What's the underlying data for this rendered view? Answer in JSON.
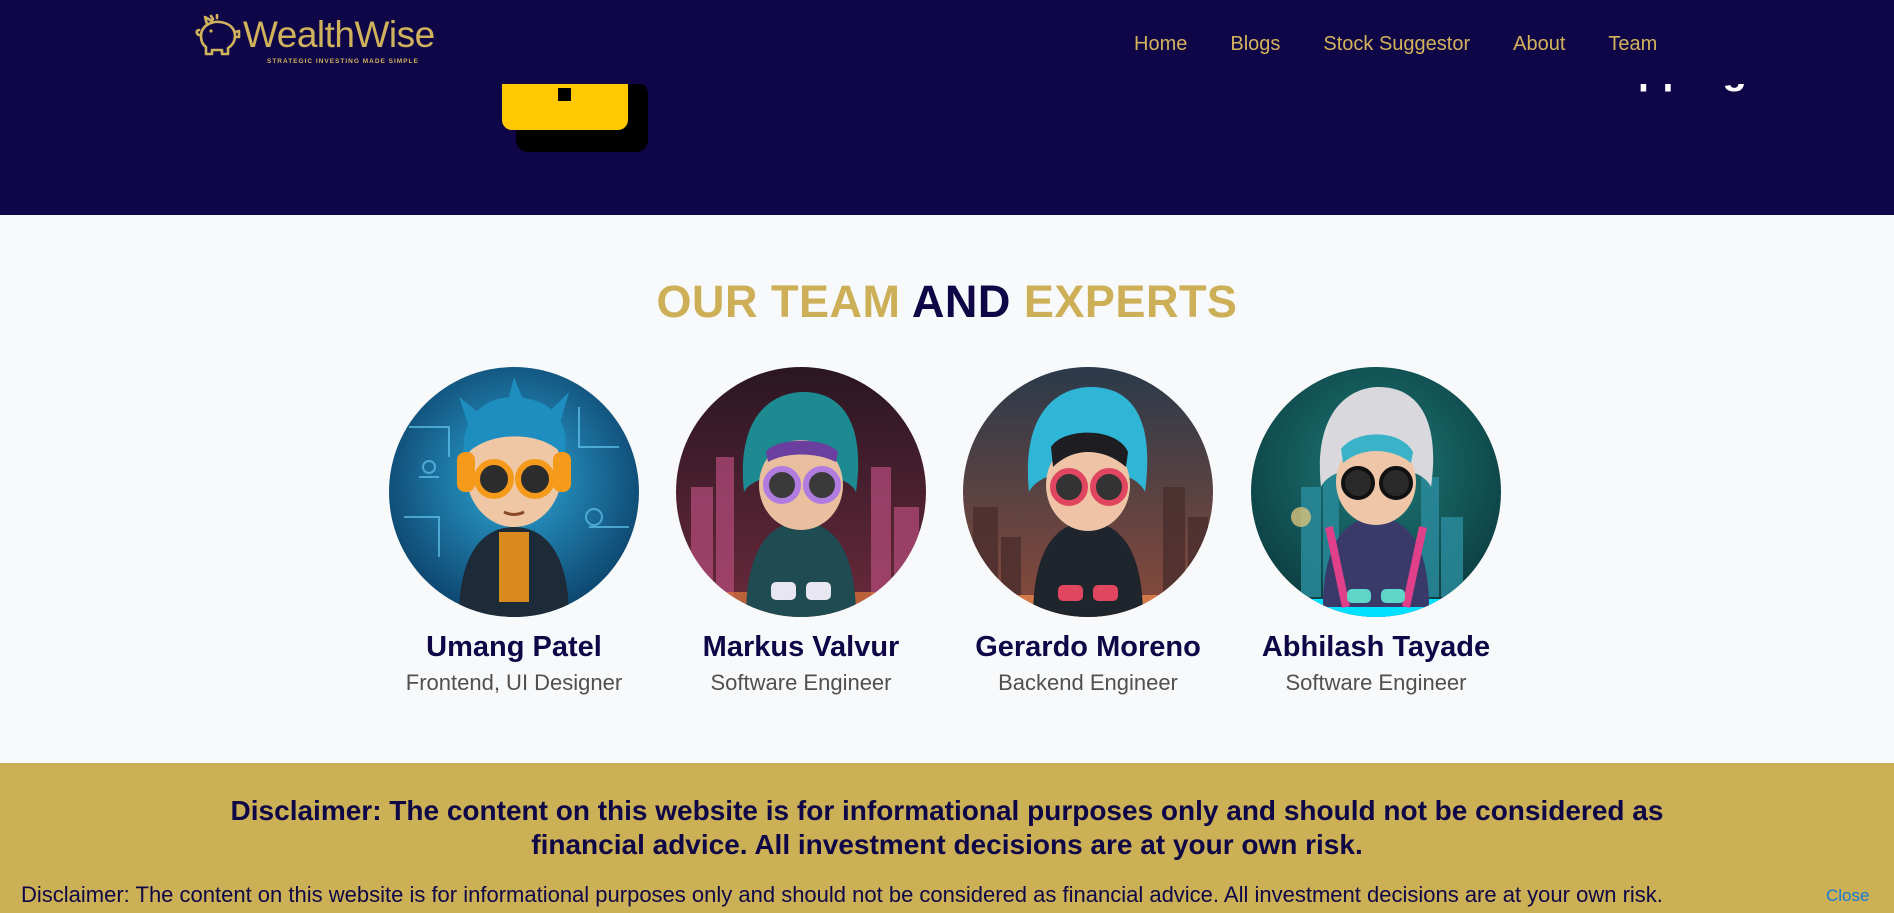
{
  "brand": {
    "name": "WealthWise",
    "tagline": "STRATEGIC INVESTING MADE SIMPLE",
    "color": "#d0b25c"
  },
  "nav": {
    "items": [
      "Home",
      "Blogs",
      "Stock Suggestor",
      "About",
      "Team"
    ]
  },
  "hero": {
    "question": "What the investment and stock mapping?",
    "background": "#0e0647",
    "icon": "wallet-icon"
  },
  "team": {
    "heading_part1": "OUR TEAM",
    "heading_part2": "AND",
    "heading_part3": "EXPERTS",
    "members": [
      {
        "name": "Umang Patel",
        "role": "Frontend, UI Designer",
        "avatar": "avatar-umang"
      },
      {
        "name": "Markus Valvur",
        "role": "Software Engineer",
        "avatar": "avatar-markus"
      },
      {
        "name": "Gerardo Moreno",
        "role": "Backend Engineer",
        "avatar": "avatar-gerardo"
      },
      {
        "name": "Abhilash Tayade",
        "role": "Software Engineer",
        "avatar": "avatar-abhilash"
      }
    ]
  },
  "disclaimer": {
    "main": "Disclaimer: The content on this website is for informational purposes only and should not be considered as financial advice. All investment decisions are at your own risk.",
    "small": "Disclaimer: The content on this website is for informational purposes only and should not be considered as financial advice. All investment decisions are at your own risk.",
    "close_label": "Close",
    "band_color": "#cbb055"
  },
  "colors": {
    "navy": "#0e0647",
    "gold": "#cdaf57",
    "page_bg": "#f8f9fa"
  }
}
